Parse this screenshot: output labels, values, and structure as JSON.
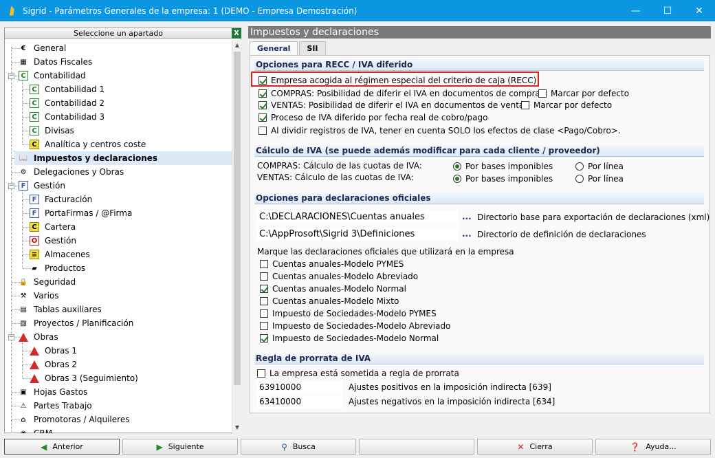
{
  "window": {
    "title": "Sigrid - Parámetros Generales de la empresa: 1 (DEMO - Empresa Demostración)",
    "minimize": "—",
    "maximize": "☐",
    "close": "✕"
  },
  "sidebar": {
    "header": "Seleccione un apartado",
    "excel": "X",
    "items": [
      {
        "label": "General",
        "icon": "euro-icon",
        "glyph": "€"
      },
      {
        "label": "Datos Fiscales",
        "icon": "fiscal-data-icon",
        "glyph": "▦"
      },
      {
        "label": "Contabilidad",
        "icon": "accounting-icon",
        "glyph": "C"
      },
      {
        "label": "Contabilidad 1",
        "icon": "accounting-icon",
        "glyph": "C"
      },
      {
        "label": "Contabilidad 2",
        "icon": "accounting-icon",
        "glyph": "C"
      },
      {
        "label": "Contabilidad 3",
        "icon": "accounting-icon",
        "glyph": "C"
      },
      {
        "label": "Divisas",
        "icon": "accounting-icon",
        "glyph": "C"
      },
      {
        "label": "Analítica y centros coste",
        "icon": "accounting-icon",
        "glyph": "C"
      },
      {
        "label": "Impuestos y declaraciones",
        "icon": "book-icon",
        "glyph": "📖"
      },
      {
        "label": "Delegaciones y Obras",
        "icon": "delegation-icon",
        "glyph": "⚙"
      },
      {
        "label": "Gestión",
        "icon": "management-icon",
        "glyph": "F"
      },
      {
        "label": "Facturación",
        "icon": "invoice-icon",
        "glyph": "F"
      },
      {
        "label": "PortaFirmas / @Firma",
        "icon": "signature-icon",
        "glyph": "F"
      },
      {
        "label": "Cartera",
        "icon": "wallet-icon",
        "glyph": "C"
      },
      {
        "label": "Gestión",
        "icon": "management-o-icon",
        "glyph": "O"
      },
      {
        "label": "Almacenes",
        "icon": "warehouse-icon",
        "glyph": "≡"
      },
      {
        "label": "Productos",
        "icon": "eraser-icon",
        "glyph": "▰"
      },
      {
        "label": "Seguridad",
        "icon": "lock-icon",
        "glyph": "🔒"
      },
      {
        "label": "Varios",
        "icon": "tools-icon",
        "glyph": "⚒"
      },
      {
        "label": "Tablas auxiliares",
        "icon": "tables-icon",
        "glyph": "▤"
      },
      {
        "label": "Proyectos / Planificación",
        "icon": "project-icon",
        "glyph": "▧"
      },
      {
        "label": "Obras",
        "icon": "cone-icon",
        "glyph": ""
      },
      {
        "label": "Obras 1",
        "icon": "cone-icon",
        "glyph": ""
      },
      {
        "label": "Obras 2",
        "icon": "cone-icon",
        "glyph": ""
      },
      {
        "label": "Obras 3 (Seguimiento)",
        "icon": "cone-icon",
        "glyph": ""
      },
      {
        "label": "Hojas Gastos",
        "icon": "expenses-icon",
        "glyph": "▣"
      },
      {
        "label": "Partes Trabajo",
        "icon": "workparts-icon",
        "glyph": "⚠"
      },
      {
        "label": "Promotoras / Alquileres",
        "icon": "house-icon",
        "glyph": "⌂"
      },
      {
        "label": "CRM",
        "icon": "crm-icon",
        "glyph": "◉"
      }
    ]
  },
  "main": {
    "title": "Impuestos y declaraciones",
    "tabs": [
      "General",
      "SII"
    ],
    "recc": {
      "heading": "Opciones para RECC / IVA diferido",
      "empresa_recc": "Empresa acogida al régimen especial del criterio de caja (RECC)",
      "compras": "COMPRAS: Posibilidad de diferir el IVA en documentos de compra",
      "compras_marcar": "Marcar por defecto",
      "ventas": "VENTAS: Posibilidad de diferir el IVA en documentos de venta",
      "ventas_marcar": "Marcar por defecto",
      "proceso": "Proceso de IVA diferido por fecha real de cobro/pago",
      "dividir": "Al dividir registros de IVA, tener en cuenta SOLO los efectos de clase <Pago/Cobro>."
    },
    "calculo": {
      "heading": "Cálculo de IVA (se puede además modificar para cada cliente / proveedor)",
      "compras_label": "COMPRAS: Cálculo de las cuotas de IVA:",
      "ventas_label": "VENTAS: Cálculo de las cuotas de IVA:",
      "por_bases": "Por bases imponibles",
      "por_linea": "Por línea"
    },
    "declaraciones": {
      "heading": "Opciones para declaraciones oficiales",
      "dir_base_value": "C:\\DECLARACIONES\\Cuentas anuales",
      "dir_base_label": "Directorio base para exportación de declaraciones (xml)",
      "dir_def_value": "C:\\AppProsoft\\Sigrid 3\\Definiciones",
      "dir_def_label": "Directorio de definición de declaraciones",
      "ellipsis": "...",
      "marque": "Marque las declaraciones oficiales que utilizará en la empresa",
      "modelos": [
        {
          "label": "Cuentas anuales-Modelo PYMES",
          "checked": false
        },
        {
          "label": "Cuentas anuales-Modelo Abreviado",
          "checked": false
        },
        {
          "label": "Cuentas anuales-Modelo Normal",
          "checked": true
        },
        {
          "label": "Cuentas anuales-Modelo Mixto",
          "checked": false
        },
        {
          "label": "Impuesto de Sociedades-Modelo PYMES",
          "checked": false
        },
        {
          "label": "Impuesto de Sociedades-Modelo Abreviado",
          "checked": false
        },
        {
          "label": "Impuesto de Sociedades-Modelo Normal",
          "checked": true
        }
      ]
    },
    "prorrata": {
      "heading": "Regla de prorrata de IVA",
      "sometida": "La empresa está sometida a regla de prorrata",
      "positivos_value": "63910000",
      "positivos_label": "Ajustes positivos en la imposición indirecta [639]",
      "negativos_value": "63410000",
      "negativos_label": "Ajustes negativos en la imposición indirecta [634]"
    }
  },
  "footer": {
    "anterior": "Anterior",
    "siguiente": "Siguiente",
    "busca": "Busca",
    "cierra": "Cierra",
    "ayuda": "Ayuda..."
  }
}
